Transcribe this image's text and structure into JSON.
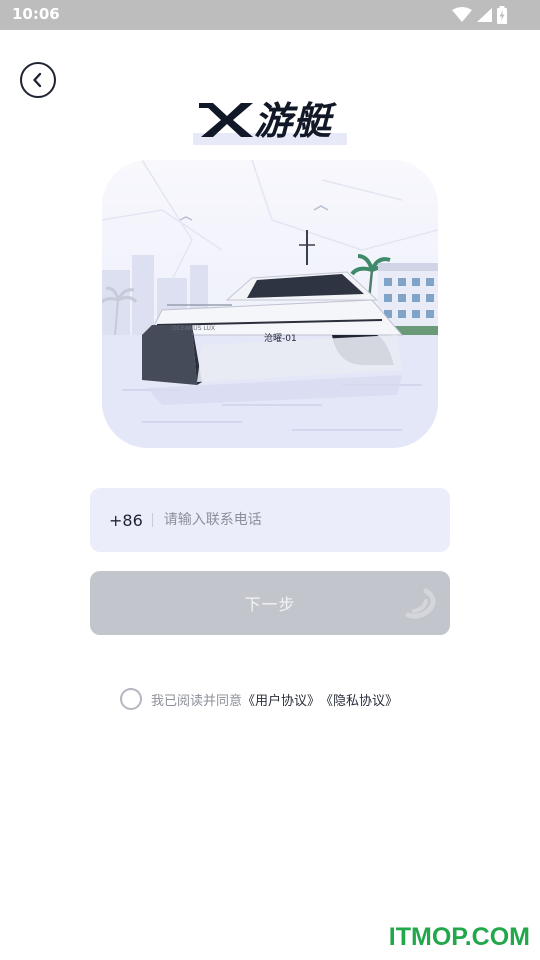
{
  "status_bar": {
    "time": "10:06",
    "icons": [
      "wifi-icon",
      "signal-icon",
      "battery-icon"
    ]
  },
  "header": {
    "back_icon": "chevron-left-icon",
    "logo_text": "游艇"
  },
  "hero": {
    "hull_text": "OCEANUS LUX",
    "boat_name": "沧曜-01"
  },
  "phone": {
    "prefix": "+86",
    "placeholder": "请输入联系电话",
    "value": ""
  },
  "next_button": {
    "label": "下一步"
  },
  "agreement": {
    "text": "我已阅读并同意",
    "user_agreement": "《用户协议》",
    "privacy_policy": "《隐私协议》"
  },
  "watermark": "ITMOP.COM",
  "colors": {
    "input_bg": "#ebedfb",
    "button_disabled": "#c3c5cc",
    "text_dark": "#1f2433",
    "watermark": "#22a84a"
  }
}
